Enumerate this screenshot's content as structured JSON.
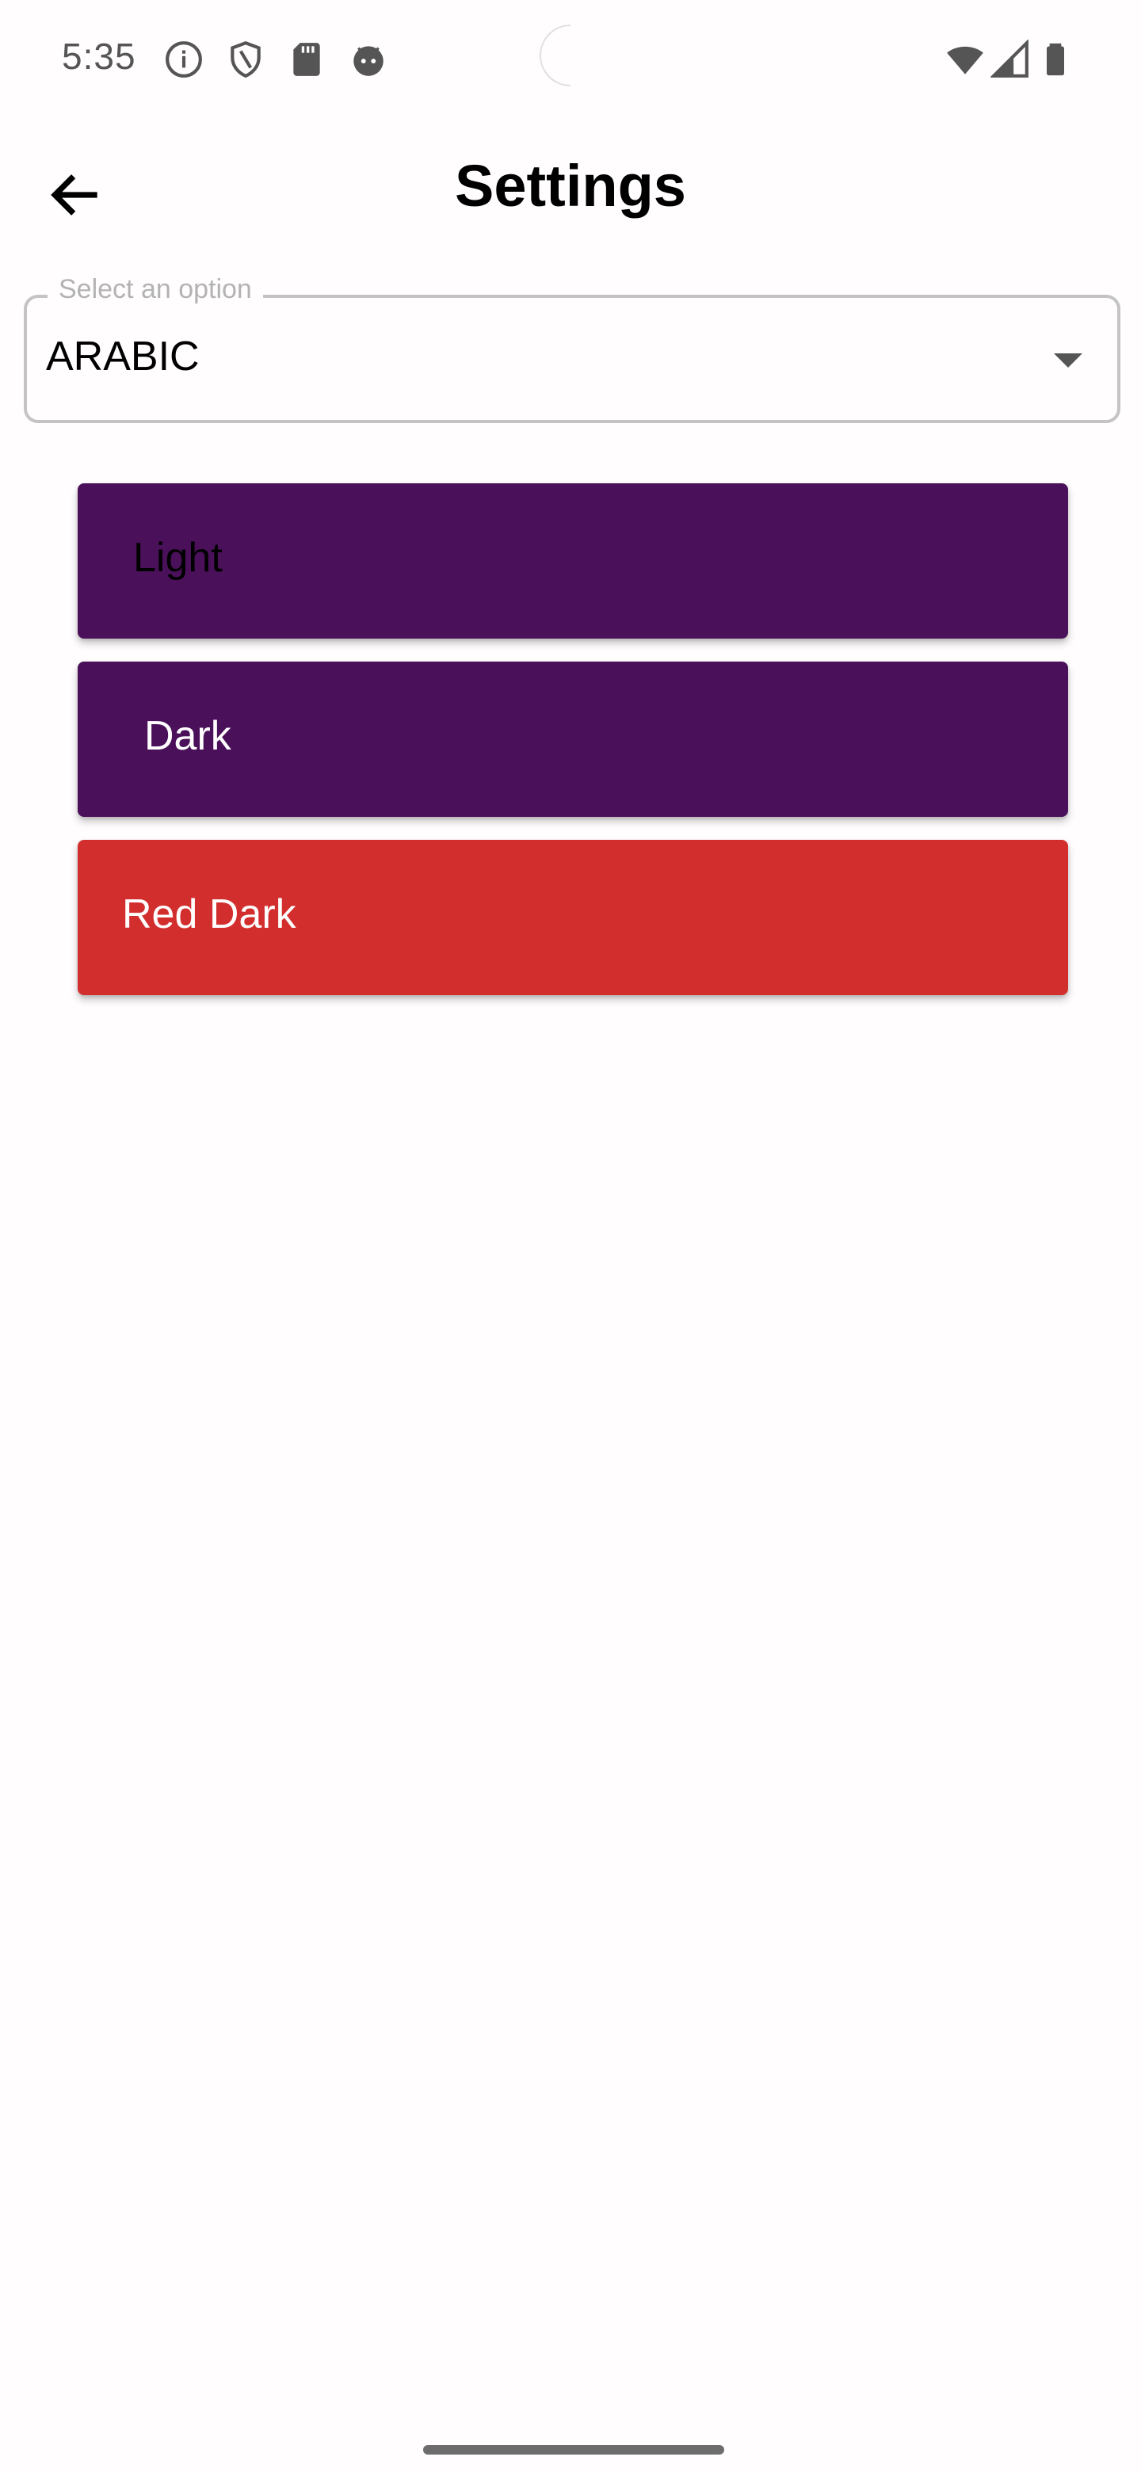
{
  "status_bar": {
    "time": "5:35",
    "icons": [
      "info-icon",
      "shield-icon",
      "sd-card-icon",
      "android-face-icon",
      "wifi-icon",
      "cell-signal-icon",
      "battery-icon"
    ]
  },
  "app_bar": {
    "back_icon": "arrow-back-icon",
    "title": "Settings"
  },
  "language_select": {
    "label": "Select an option",
    "value": "ARABIC",
    "caret_icon": "dropdown-caret-icon"
  },
  "themes": [
    {
      "label": "Light",
      "background": "#4a105a",
      "text_color": "#000000"
    },
    {
      "label": "Dark",
      "background": "#4a105a",
      "text_color": "#ffffff"
    },
    {
      "label": "Red Dark",
      "background": "#d32e2e",
      "text_color": "#ffffff"
    }
  ],
  "colors": {
    "page_background": "#fffdfe",
    "outline": "#c4c4c4",
    "hint_text": "#b3b3b3"
  }
}
